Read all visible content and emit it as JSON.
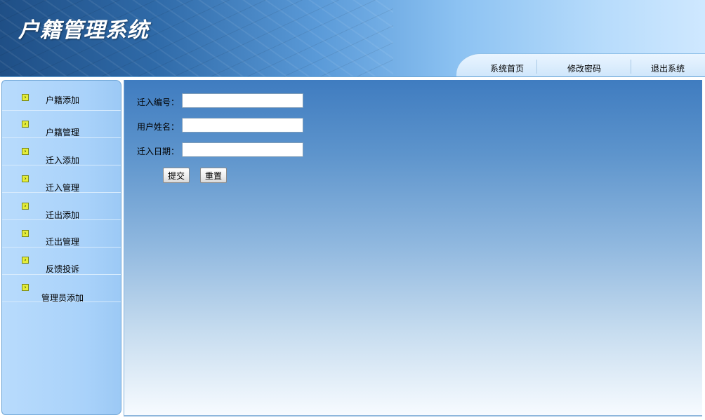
{
  "app": {
    "title": "户籍管理系统"
  },
  "topnav": {
    "home": "系统首页",
    "change_password": "修改密码",
    "logout": "退出系统"
  },
  "sidebar": {
    "items": [
      {
        "label": "户籍添加"
      },
      {
        "label": "户籍管理"
      },
      {
        "label": "迁入添加"
      },
      {
        "label": "迁入管理"
      },
      {
        "label": "迁出添加"
      },
      {
        "label": "迁出管理"
      },
      {
        "label": "反馈投诉"
      },
      {
        "label": "管理员添加"
      }
    ]
  },
  "form": {
    "fields": [
      {
        "label": "迁入编号：",
        "value": "",
        "placeholder": ""
      },
      {
        "label": "用户姓名：",
        "value": "",
        "placeholder": ""
      },
      {
        "label": "迁入日期：",
        "value": "",
        "placeholder": ""
      }
    ],
    "submit_label": "提交",
    "reset_label": "重置"
  },
  "icons": {
    "menu_bullet": "arrow-right-icon"
  },
  "colors": {
    "header_dark": "#1f4f86",
    "header_light": "#cfe8ff",
    "sidebar": "#a9d2fa",
    "bullet": "#e6ee3a"
  }
}
